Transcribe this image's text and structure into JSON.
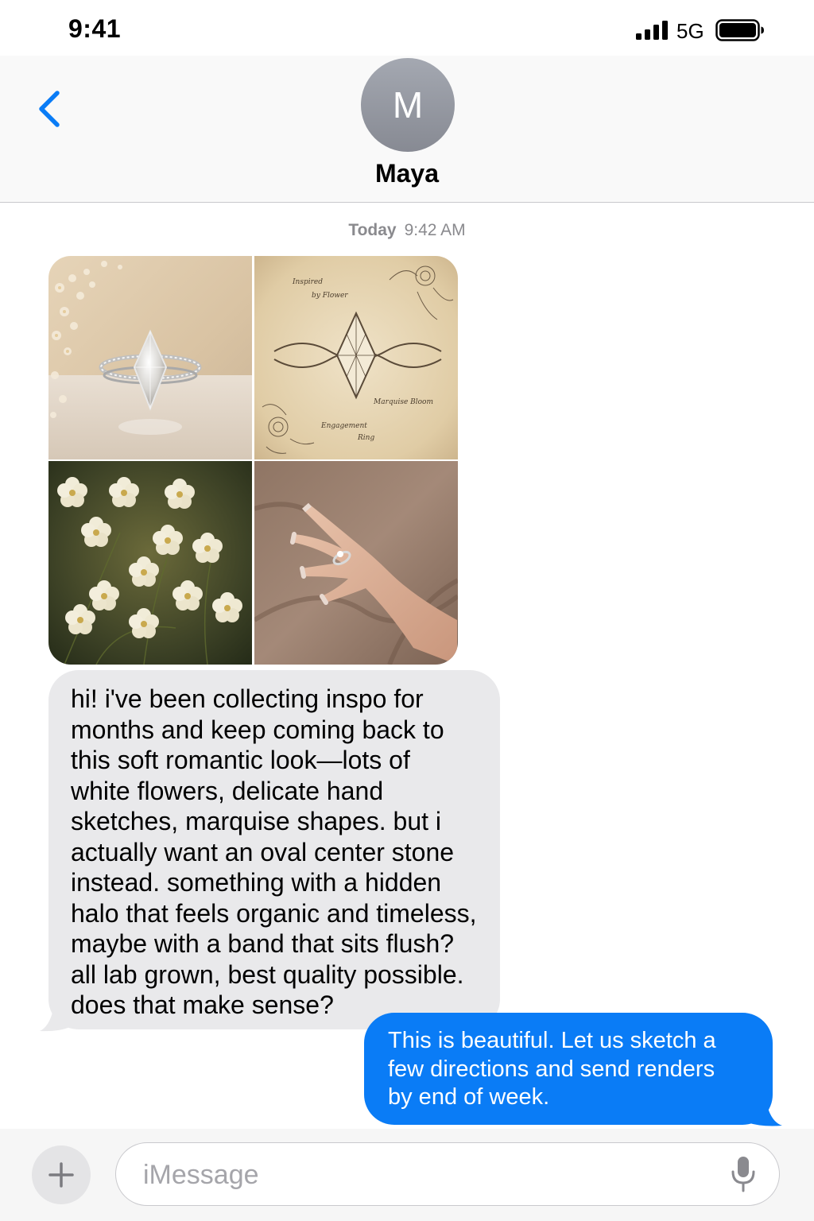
{
  "status_bar": {
    "time": "9:41",
    "network": "5G",
    "signal_bars": 4,
    "battery_level": 1.0,
    "icons": [
      "signal-icon",
      "battery-icon"
    ]
  },
  "header": {
    "avatar_initial": "M",
    "contact_name": "Maya",
    "icons": [
      "back-chevron-icon"
    ]
  },
  "conversation": {
    "timestamp_day": "Today",
    "timestamp_time": "9:42 AM",
    "photos": [
      {
        "subject": "marquise diamond engagement ring on marble with baby's breath flowers"
      },
      {
        "subject": "vintage pencil sketch of ring with botanical drawings",
        "caption_top": "Inspired by Flower",
        "caption_right": "Marquise Bloom",
        "caption_bottom": "Engagement Ring"
      },
      {
        "subject": "cluster of small white flowers on dark green background"
      },
      {
        "subject": "hand wearing ring against taupe silk fabric"
      }
    ],
    "incoming_lines": [
      "hi! i've been collecting inspo for",
      "months and keep coming back to",
      "this soft romantic look—lots of",
      "white flowers, delicate hand",
      "sketches, marquise shapes. but i",
      "actually want an oval center stone",
      "instead. something with a hidden",
      "halo that feels organic and timeless,",
      "maybe with a band that sits flush?",
      "all lab grown, best quality possible.",
      "does that make sense?"
    ],
    "outgoing_lines": [
      "This is beautiful. Let us sketch a",
      "few directions and send renders",
      "by end of week."
    ]
  },
  "input_bar": {
    "placeholder": "iMessage",
    "value": "",
    "icons": [
      "plus-icon",
      "microphone-icon"
    ]
  },
  "colors": {
    "accent_blue": "#0a7cf6",
    "incoming_bubble": "#e9e9eb",
    "avatar_gray": "#8e9199"
  }
}
